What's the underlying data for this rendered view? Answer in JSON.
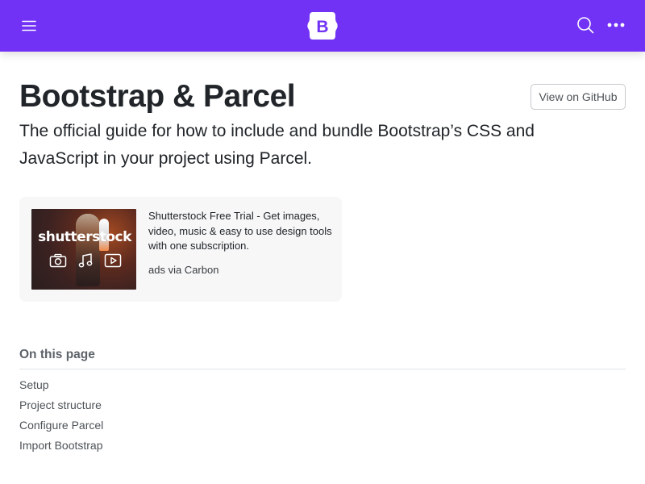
{
  "navbar": {
    "background": "#7132f5",
    "menu_icon": "hamburger-icon",
    "brand_icon": "bootstrap-logo",
    "brand_letter": "B",
    "search_icon": "search-icon",
    "more_icon": "more-horizontal-icon"
  },
  "page": {
    "title": "Bootstrap & Parcel",
    "lead": "The official guide for how to include and bundle Bootstrap’s CSS and JavaScript in your project using Parcel.",
    "github_button": "View on GitHub"
  },
  "ad": {
    "logo_text": "shutterstock",
    "media_icons": [
      "camera-icon",
      "music-note-icon",
      "play-icon"
    ],
    "description": "Shutterstock Free Trial - Get images, video, music & easy to use design tools with one subscription.",
    "via": "ads via Carbon"
  },
  "toc": {
    "title": "On this page",
    "items": [
      "Setup",
      "Project structure",
      "Configure Parcel",
      "Import Bootstrap"
    ]
  }
}
